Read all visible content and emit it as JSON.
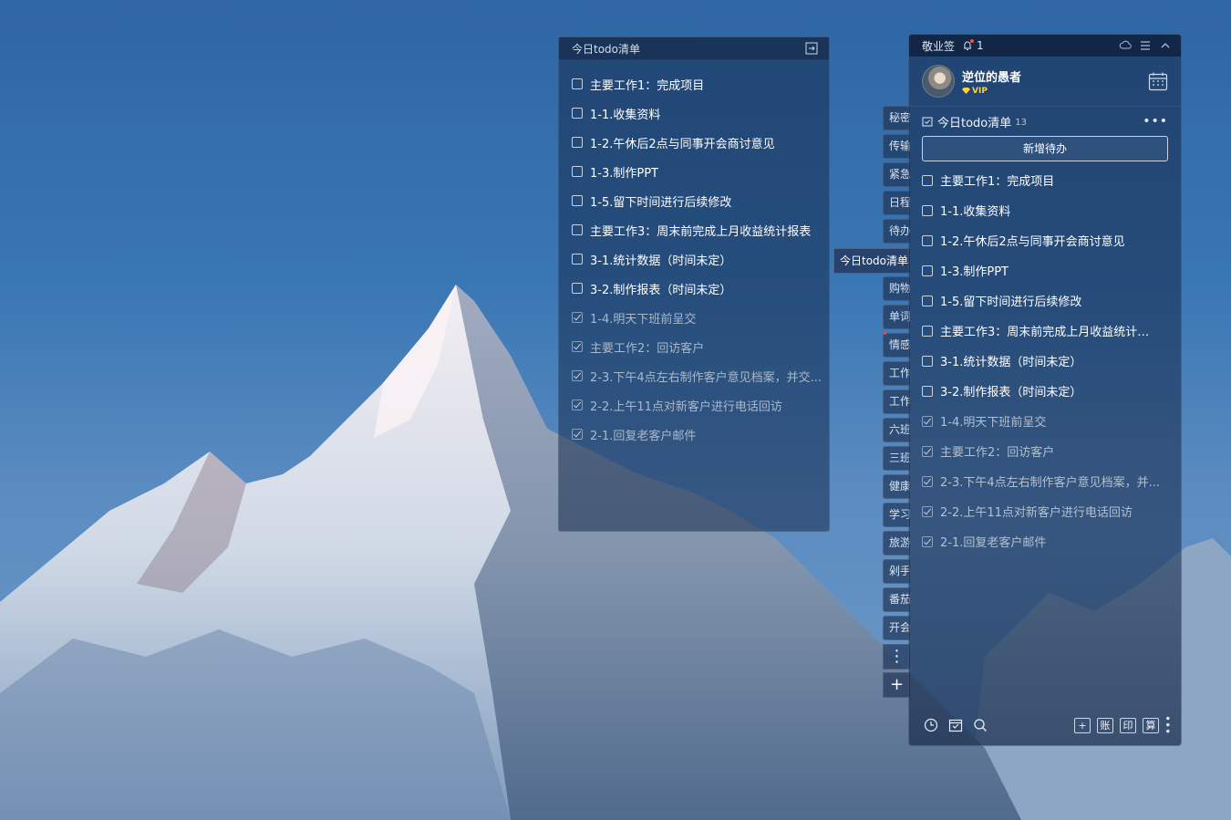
{
  "float_panel": {
    "title": "今日todo清单",
    "items": [
      {
        "text": "主要工作1：完成项目",
        "done": false
      },
      {
        "text": "1-1.收集资料",
        "done": false
      },
      {
        "text": "1-2.午休后2点与同事开会商讨意见",
        "done": false
      },
      {
        "text": "1-3.制作PPT",
        "done": false
      },
      {
        "text": "1-5.留下时间进行后续修改",
        "done": false
      },
      {
        "text": "主要工作3：周末前完成上月收益统计报表",
        "done": false
      },
      {
        "text": "3-1.统计数据（时间未定）",
        "done": false
      },
      {
        "text": "3-2.制作报表（时间未定）",
        "done": false
      },
      {
        "text": "1-4.明天下班前呈交",
        "done": true
      },
      {
        "text": "主要工作2：回访客户",
        "done": true
      },
      {
        "text": "2-3.下午4点左右制作客户意见档案，并交...",
        "done": true
      },
      {
        "text": "2-2.上午11点对新客户进行电话回访",
        "done": true
      },
      {
        "text": "2-1.回复老客户邮件",
        "done": true
      }
    ]
  },
  "tabs": {
    "active": "今日todo清单",
    "items": [
      "秘密",
      "传输",
      "紧急",
      "日程",
      "待办",
      "购物",
      "单词",
      "情感",
      "工作",
      "工作",
      "六班",
      "三班",
      "健康",
      "学习",
      "旅游",
      "剁手",
      "番茄",
      "开会"
    ]
  },
  "main_panel": {
    "app_title": "敬业签",
    "notify_count": "1",
    "user_name": "逆位的愚者",
    "vip_label": "VIP",
    "list_title": "今日todo清单",
    "list_count": "13",
    "more": "•••",
    "new_todo_label": "新增待办",
    "items": [
      {
        "text": "主要工作1：完成项目",
        "done": false
      },
      {
        "text": "1-1.收集资料",
        "done": false
      },
      {
        "text": "1-2.午休后2点与同事开会商讨意见",
        "done": false
      },
      {
        "text": "1-3.制作PPT",
        "done": false
      },
      {
        "text": "1-5.留下时间进行后续修改",
        "done": false
      },
      {
        "text": "主要工作3：周末前完成上月收益统计报表",
        "done": false
      },
      {
        "text": "3-1.统计数据（时间未定）",
        "done": false
      },
      {
        "text": "3-2.制作报表（时间未定）",
        "done": false
      },
      {
        "text": "1-4.明天下班前呈交",
        "done": true
      },
      {
        "text": "主要工作2：回访客户",
        "done": true
      },
      {
        "text": "2-3.下午4点左右制作客户意见档案，并...",
        "done": true
      },
      {
        "text": "2-2.上午11点对新客户进行电话回访",
        "done": true
      },
      {
        "text": "2-1.回复老客户邮件",
        "done": true
      }
    ],
    "bottom_buttons": [
      "+",
      "账",
      "印",
      "算"
    ],
    "bottom_icons": [
      "clock-icon",
      "calendar-check-icon",
      "search-icon"
    ]
  },
  "colors": {
    "sky_top": "#2f66a3",
    "panel_bg": "#162848",
    "vip_gold": "#ffd23a",
    "badge_red": "#ff4a3a"
  }
}
